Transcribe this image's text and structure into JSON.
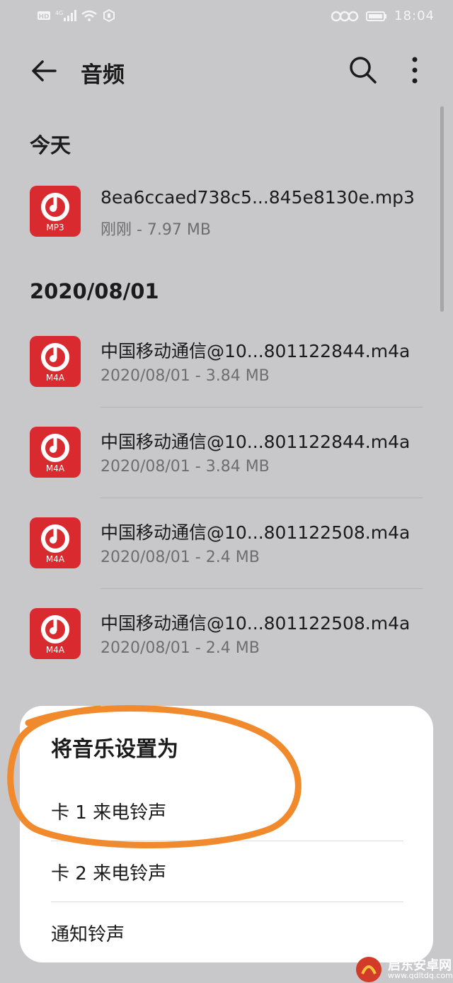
{
  "status_bar": {
    "left_text": "HD 4G",
    "time": "18:04"
  },
  "app_bar": {
    "title": "音频"
  },
  "sections": [
    {
      "header": "今天",
      "files": [
        {
          "name": "8ea6ccaed738c5...845e8130e.mp3",
          "meta": "刚刚 - 7.97 MB",
          "ext": "MP3"
        }
      ]
    },
    {
      "header": "2020/08/01",
      "files": [
        {
          "name": "中国移动通信@10...801122844.m4a",
          "meta": "2020/08/01 - 3.84 MB",
          "ext": "M4A"
        },
        {
          "name": "中国移动通信@10...801122844.m4a",
          "meta": "2020/08/01 - 3.84 MB",
          "ext": "M4A"
        },
        {
          "name": "中国移动通信@10...801122508.m4a",
          "meta": "2020/08/01 - 2.4 MB",
          "ext": "M4A"
        },
        {
          "name": "中国移动通信@10...801122508.m4a",
          "meta": "2020/08/01 - 2.4 MB",
          "ext": "M4A"
        }
      ]
    }
  ],
  "sheet": {
    "title": "将音乐设置为",
    "options": [
      "卡 1 来电铃声",
      "卡 2 来电铃声",
      "通知铃声"
    ]
  },
  "annotation_color": "#f08a2c",
  "icons": {
    "back": "arrow-left-icon",
    "search": "search-icon",
    "more": "more-vertical-icon",
    "music": "music-disc-icon"
  },
  "watermark": {
    "text": "启东安卓网",
    "url": "www.qdltdq.com"
  }
}
